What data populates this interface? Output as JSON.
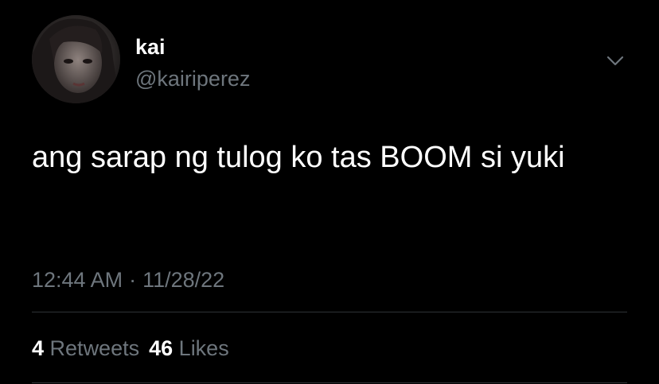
{
  "tweet": {
    "display_name": "kai",
    "handle": "@kairiperez",
    "text": "ang sarap ng tulog ko tas BOOM si yuki",
    "time": "12:44 AM",
    "separator": "·",
    "date": "11/28/22",
    "retweets_count": "4",
    "retweets_label": "Retweets",
    "likes_count": "46",
    "likes_label": "Likes"
  },
  "icons": {
    "more_options": "chevron-down-icon",
    "avatar": "profile-photo"
  },
  "colors": {
    "background": "#000000",
    "primary_text": "#ffffff",
    "secondary_text": "#6e767d",
    "divider": "#2f3336"
  }
}
